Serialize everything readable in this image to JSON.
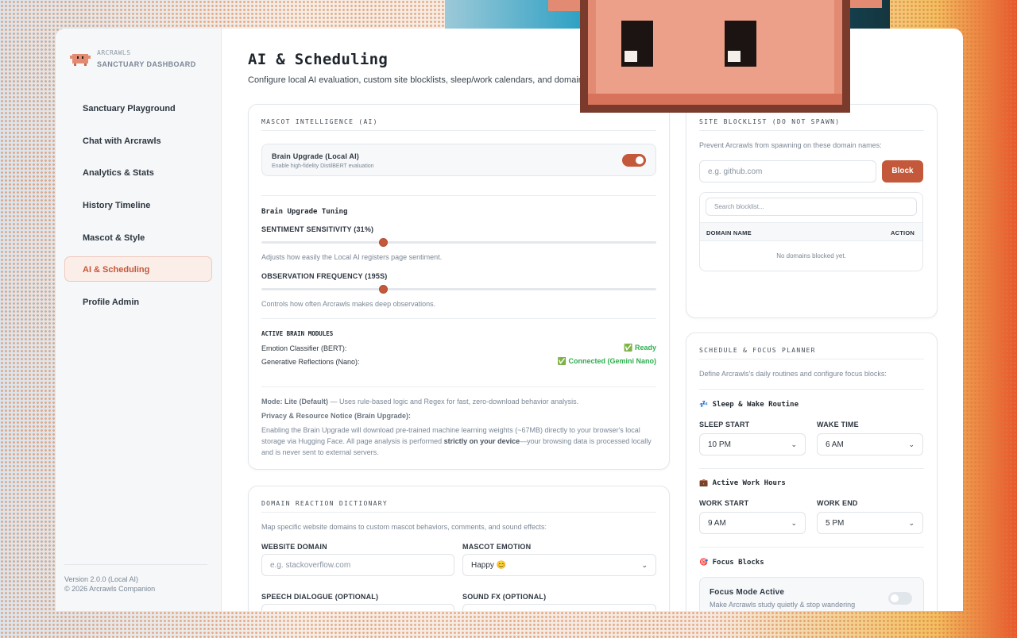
{
  "brand": {
    "name": "ARCRAWLS",
    "subtitle": "SANCTUARY DASHBOARD"
  },
  "sidebar": {
    "items": [
      {
        "label": "Sanctuary Playground",
        "active": false
      },
      {
        "label": "Chat with Arcrawls",
        "active": false
      },
      {
        "label": "Analytics & Stats",
        "active": false
      },
      {
        "label": "History Timeline",
        "active": false
      },
      {
        "label": "Mascot & Style",
        "active": false
      },
      {
        "label": "AI & Scheduling",
        "active": true
      },
      {
        "label": "Profile Admin",
        "active": false
      }
    ],
    "version": "Version 2.0.0 (Local AI)",
    "copyright": "© 2026 Arcrawls Companion"
  },
  "page": {
    "title": "AI & Scheduling",
    "subtitle": "Configure local AI evaluation, custom site blocklists, sleep/work calendars, and domain"
  },
  "ai": {
    "heading": "MASCOT INTELLIGENCE (AI)",
    "upgrade_title": "Brain Upgrade (Local AI)",
    "upgrade_desc": "Enable high-fidelity DistilBERT evaluation",
    "upgrade_enabled": true,
    "tuning_title": "Brain Upgrade Tuning",
    "sensitivity_label": "SENTIMENT SENSITIVITY (31%)",
    "sensitivity_value": 0.31,
    "sensitivity_desc": "Adjusts how easily the Local AI registers page sentiment.",
    "frequency_label": "OBSERVATION FREQUENCY (195S)",
    "frequency_value": 0.31,
    "frequency_desc": "Controls how often Arcrawls makes deep observations.",
    "modules_title": "ACTIVE BRAIN MODULES",
    "modules": [
      {
        "name": "Emotion Classifier (BERT):",
        "status": "✅ Ready"
      },
      {
        "name": "Generative Reflections (Nano):",
        "status": "✅ Connected (Gemini Nano)"
      }
    ],
    "mode_bold": "Mode: Lite (Default)",
    "mode_text": " — Uses rule-based logic and Regex for fast, zero-download behavior analysis.",
    "privacy_title": "Privacy & Resource Notice (Brain Upgrade):",
    "privacy_text_1": "Enabling the Brain Upgrade will download pre-trained machine learning weights (~67MB) directly to your browser's local storage via Hugging Face. All page analysis is performed ",
    "privacy_bold": "strictly on your device",
    "privacy_text_2": "—your browsing data is processed locally and is never sent to external servers."
  },
  "dictionary": {
    "heading": "DOMAIN REACTION DICTIONARY",
    "desc": "Map specific website domains to custom mascot behaviors, comments, and sound effects:",
    "domain_label": "WEBSITE DOMAIN",
    "domain_placeholder": "e.g. stackoverflow.com",
    "emotion_label": "MASCOT EMOTION",
    "emotion_value": "Happy 😊",
    "speech_label": "SPEECH DIALOGUE (OPTIONAL)",
    "sound_label": "SOUND FX (OPTIONAL)"
  },
  "blocklist": {
    "heading": "SITE BLOCKLIST (DO NOT SPAWN)",
    "desc": "Prevent Arcrawls from spawning on these domain names:",
    "input_placeholder": "e.g. github.com",
    "block_label": "Block",
    "search_placeholder": "Search blocklist...",
    "col_domain": "DOMAIN NAME",
    "col_action": "ACTION",
    "empty": "No domains blocked yet."
  },
  "schedule": {
    "heading": "SCHEDULE & FOCUS PLANNER",
    "desc": "Define Arcrawls's daily routines and configure focus blocks:",
    "sleep_title": "💤 Sleep & Wake Routine",
    "sleep_start_label": "SLEEP START",
    "sleep_start_value": "10 PM",
    "wake_label": "WAKE TIME",
    "wake_value": "6 AM",
    "work_title": "💼 Active Work Hours",
    "work_start_label": "WORK START",
    "work_start_value": "9 AM",
    "work_end_label": "WORK END",
    "work_end_value": "5 PM",
    "focus_title": "🎯 Focus Blocks",
    "focus_mode_title": "Focus Mode Active",
    "focus_mode_desc": "Make Arcrawls study quietly & stop wandering",
    "focus_enabled": false
  },
  "colors": {
    "accent": "#c4583a",
    "success": "#2eae4e",
    "mascot": "#e38b72"
  }
}
